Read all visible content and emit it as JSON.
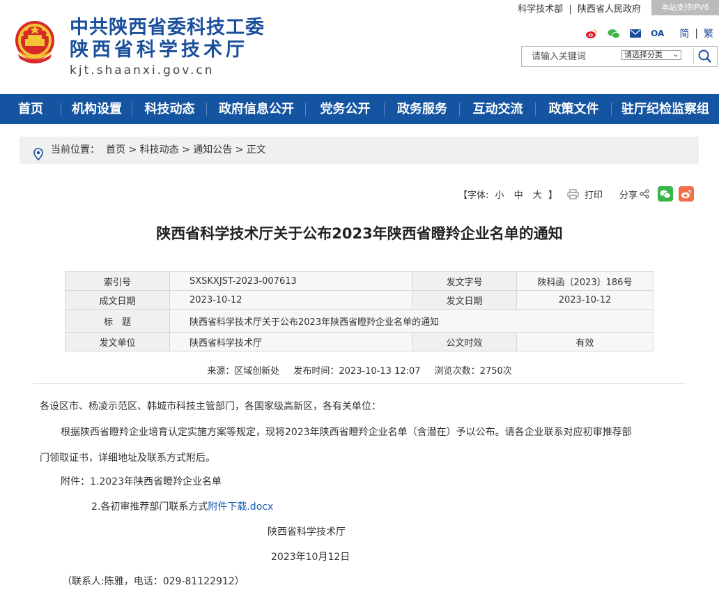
{
  "header": {
    "logo_line1": "中共陕西省委科技工委",
    "logo_line2": "陕西省科学技术厅",
    "logo_domain": "kjt.shaanxi.gov.cn",
    "top_links": [
      "科学技术部",
      "陕西省人民政府"
    ],
    "top_sep": "|",
    "ipv6": "本站支持IPV6",
    "social": {
      "oa": "OA",
      "simplified": "简",
      "traditional": "繁",
      "sep": "|"
    },
    "search": {
      "placeholder": "请输入关键词",
      "category": "请选择分类"
    }
  },
  "nav": [
    "首页",
    "机构设置",
    "科技动态",
    "政府信息公开",
    "党务公开",
    "政务服务",
    "互动交流",
    "政策文件",
    "驻厅纪检监察组"
  ],
  "breadcrumb": {
    "label": "当前位置：",
    "items": [
      "首页",
      "科技动态",
      "通知公告",
      "正文"
    ],
    "sep": " > "
  },
  "tools": {
    "font_prefix": "【字体:",
    "font_small": "小",
    "font_mid": "中",
    "font_large": "大",
    "font_suffix": "】",
    "print": "打印",
    "share": "分享"
  },
  "title": "陕西省科学技术厅关于公布2023年陕西省瞪羚企业名单的通知",
  "meta": {
    "index_label": "索引号",
    "index_value": "SXSKXJST-2023-007613",
    "docno_label": "发文字号",
    "docno_value": "陕科函〔2023〕186号",
    "created_label": "成文日期",
    "created_value": "2023-10-12",
    "issued_label": "发文日期",
    "issued_value": "2023-10-12",
    "subject_label": "标　题",
    "subject_value": "陕西省科学技术厅关于公布2023年陕西省瞪羚企业名单的通知",
    "unit_label": "发文单位",
    "unit_value": "陕西省科学技术厅",
    "validity_label": "公文时效",
    "validity_value": "有效"
  },
  "source": {
    "from": "来源：区域创新处",
    "time": "发布时间：2023-10-13 12:07",
    "views": "浏览次数：2750次"
  },
  "body": {
    "greeting": "各设区市、杨凌示范区、韩城市科技主管部门，各国家级高新区，各有关单位：",
    "para1_line1": "根据陕西省瞪羚企业培育认定实施方案等规定，现将2023年陕西省瞪羚企业名单（含潜在）予以公布。请各企业联系对应初审推荐部",
    "para1_line2": "门领取证书，详细地址及联系方式附后。",
    "attach1": "附件：1.2023年陕西省瞪羚企业名单",
    "attach2_text": "2.各初审推荐部门联系方式",
    "attach2_link": "附件下载.docx",
    "signature": "陕西省科学技术厅",
    "date": "2023年10月12日",
    "contact": "（联系人:陈雅，电话：029-81122912）"
  },
  "colors": {
    "nav_bg": "#1554a0",
    "logo_blue": "#1a4f9c",
    "wechat_green": "#3ab54a",
    "weibo_orange": "#f26f4a"
  }
}
